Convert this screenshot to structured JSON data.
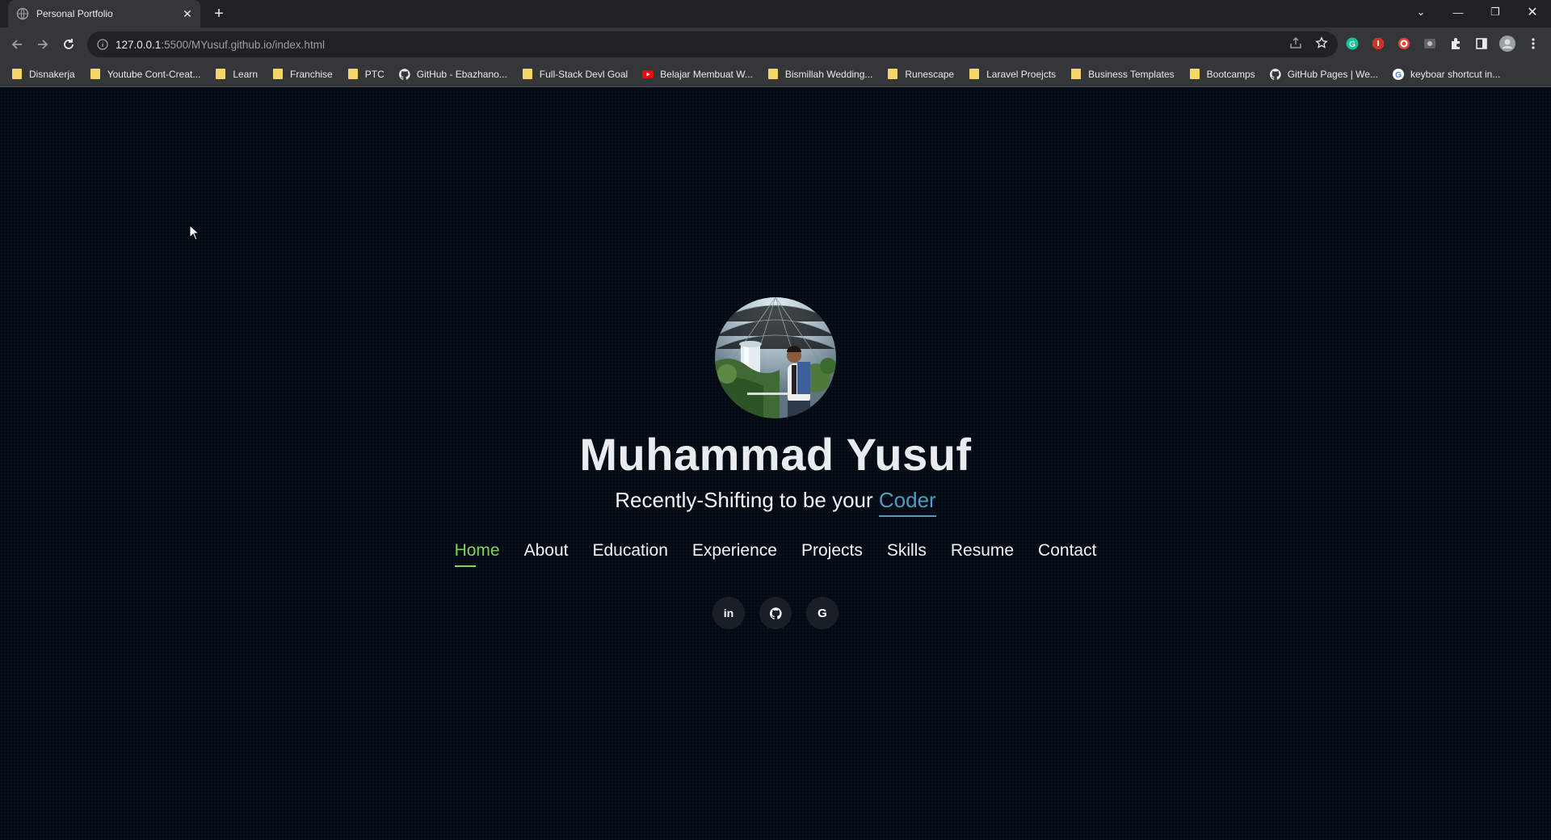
{
  "browser": {
    "tab_title": "Personal Portfolio",
    "url_host": "127.0.0.1",
    "url_rest": ":5500/MYusuf.github.io/index.html"
  },
  "bookmarks": [
    {
      "label": "Disnakerja",
      "icon": "folder-icon"
    },
    {
      "label": "Youtube Cont-Creat...",
      "icon": "folder-icon"
    },
    {
      "label": "Learn",
      "icon": "folder-icon"
    },
    {
      "label": "Franchise",
      "icon": "folder-icon"
    },
    {
      "label": "PTC",
      "icon": "folder-icon"
    },
    {
      "label": "GitHub - Ebazhano...",
      "icon": "github-icon"
    },
    {
      "label": "Full-Stack Devl Goal",
      "icon": "folder-icon"
    },
    {
      "label": "Belajar Membuat W...",
      "icon": "youtube-icon"
    },
    {
      "label": "Bismillah Wedding...",
      "icon": "folder-icon"
    },
    {
      "label": "Runescape",
      "icon": "folder-icon"
    },
    {
      "label": "Laravel Proejcts",
      "icon": "folder-icon"
    },
    {
      "label": "Business Templates",
      "icon": "folder-icon"
    },
    {
      "label": "Bootcamps",
      "icon": "folder-icon"
    },
    {
      "label": "GitHub Pages | We...",
      "icon": "github-icon"
    },
    {
      "label": "keyboar shortcut in...",
      "icon": "google-icon"
    }
  ],
  "hero": {
    "name": "Muhammad Yusuf",
    "subtitle_prefix": "Recently-Shifting to be your ",
    "subtitle_role": "Coder"
  },
  "nav": [
    {
      "label": "Home",
      "active": true
    },
    {
      "label": "About"
    },
    {
      "label": "Education"
    },
    {
      "label": "Experience"
    },
    {
      "label": "Projects"
    },
    {
      "label": "Skills"
    },
    {
      "label": "Resume"
    },
    {
      "label": "Contact"
    }
  ],
  "social": [
    {
      "label": "in",
      "icon": "linkedin-icon"
    },
    {
      "label": "",
      "icon": "github-icon"
    },
    {
      "label": "G",
      "icon": "google-icon"
    }
  ],
  "colors": {
    "accent_green": "#7fd45a",
    "accent_blue": "#4c9cc4",
    "page_bg": "#040b14"
  }
}
